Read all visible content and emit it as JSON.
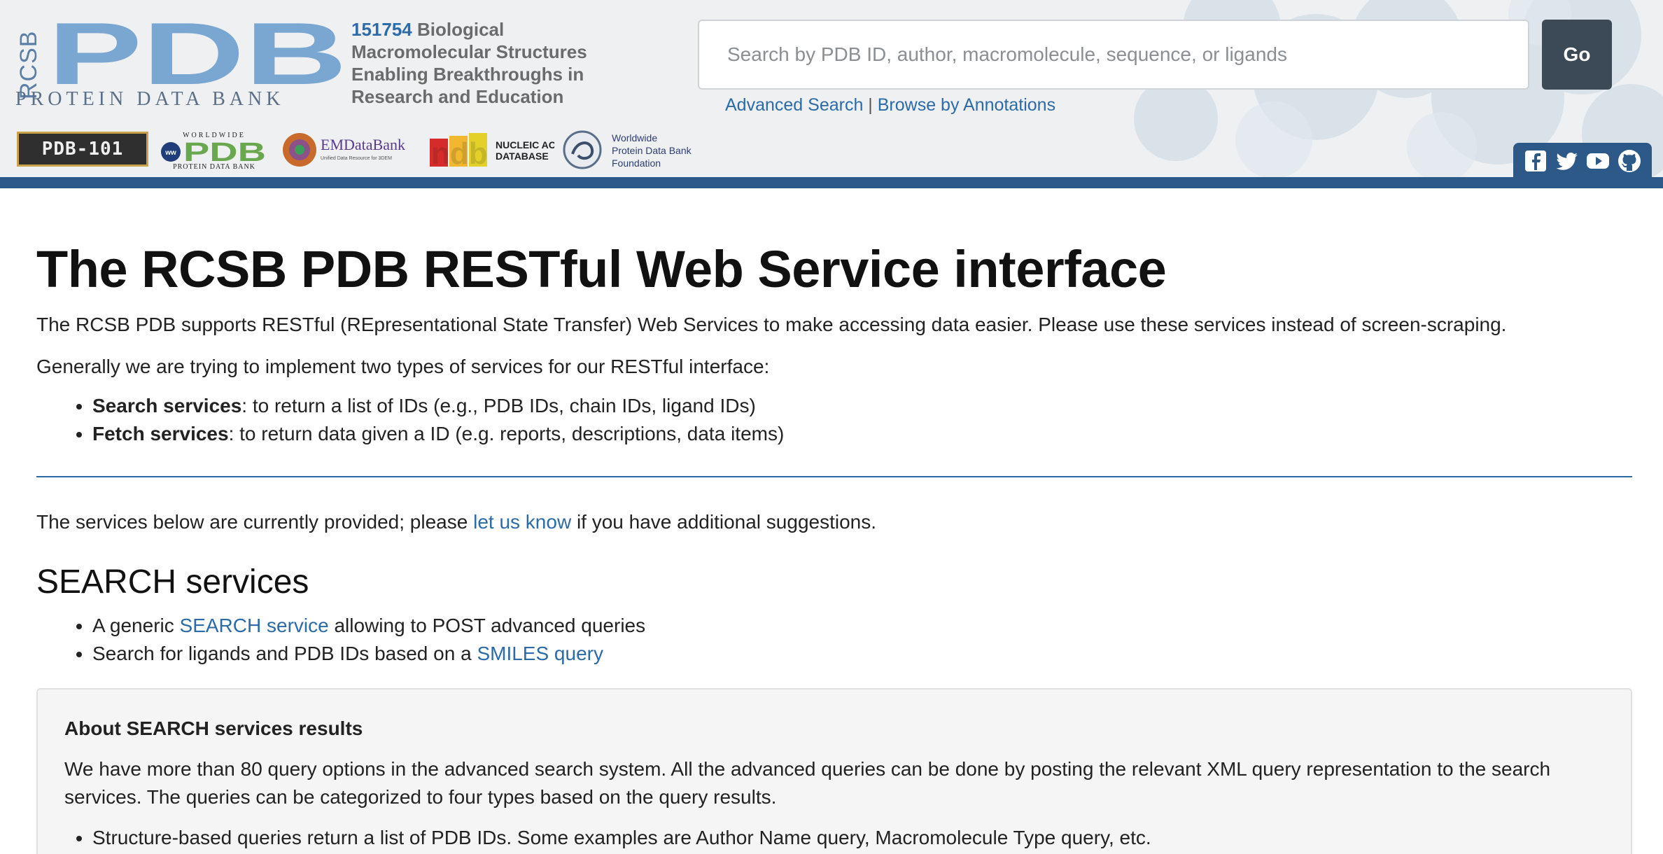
{
  "header": {
    "logo_side_text": "RCSB",
    "logo_main_text": "PDB",
    "logo_subtitle": "PROTEIN DATA BANK",
    "tagline_count": "151754",
    "tagline_rest": " Biological Macromolecular Structures Enabling Breakthroughs in Research and Education",
    "search_placeholder": "Search by PDB ID, author, macromolecule, sequence, or ligands",
    "go_label": "Go",
    "advanced_search": "Advanced Search",
    "separator": " | ",
    "browse_annotations": "Browse by Annotations",
    "partners": {
      "pdb101": "PDB-101",
      "wwpdb_top": "WORLDWIDE",
      "wwpdb_main": "PDB",
      "wwpdb_bottom": "PROTEIN DATA BANK",
      "emdb": "EMDataBank",
      "emdb_sub": "Unified Data Resource for 3DEM",
      "ndb": "ndb",
      "ndb_sub1": "NUCLEIC ACID",
      "ndb_sub2": "DATABASE",
      "wwpdbf_line1": "Worldwide",
      "wwpdbf_line2": "Protein Data Bank",
      "wwpdbf_line3": "Foundation"
    },
    "social_icons": [
      "facebook-icon",
      "twitter-icon",
      "youtube-icon",
      "github-icon"
    ]
  },
  "main": {
    "title": "The RCSB PDB RESTful Web Service interface",
    "intro": "The RCSB PDB supports RESTful (REpresentational State Transfer) Web Services to make accessing data easier. Please use these services instead of screen-scraping.",
    "intro2": "Generally we are trying to implement two types of services for our RESTful interface:",
    "service_types": [
      {
        "name": "Search services",
        "desc": ": to return a list of IDs (e.g., PDB IDs, chain IDs, ligand IDs)"
      },
      {
        "name": "Fetch services",
        "desc": ": to return data given a ID (e.g. reports, descriptions, data items)"
      }
    ],
    "provided_before": "The services below are currently provided; please ",
    "provided_link": "let us know",
    "provided_after": " if you have additional suggestions.",
    "search_heading": "SEARCH services",
    "search_items": [
      {
        "before": "A generic ",
        "link": "SEARCH service",
        "after": " allowing to POST advanced queries"
      },
      {
        "before": "Search for ligands and PDB IDs based on a ",
        "link": "SMILES query",
        "after": ""
      }
    ],
    "panel": {
      "heading": "About SEARCH services results",
      "text": "We have more than 80 query options in the advanced search system. All the advanced queries can be done by posting the relevant XML query representation to the search services. The queries can be categorized to four types based on the query results.",
      "items": [
        "Structure-based queries return a list of PDB IDs. Some examples are Author Name query, Macromolecule Type query, etc."
      ]
    }
  },
  "colors": {
    "accent": "#2c6ba8",
    "header_bar": "#2c5987",
    "go_button": "#3b4a56",
    "logo_blue": "#7aa6d2"
  }
}
